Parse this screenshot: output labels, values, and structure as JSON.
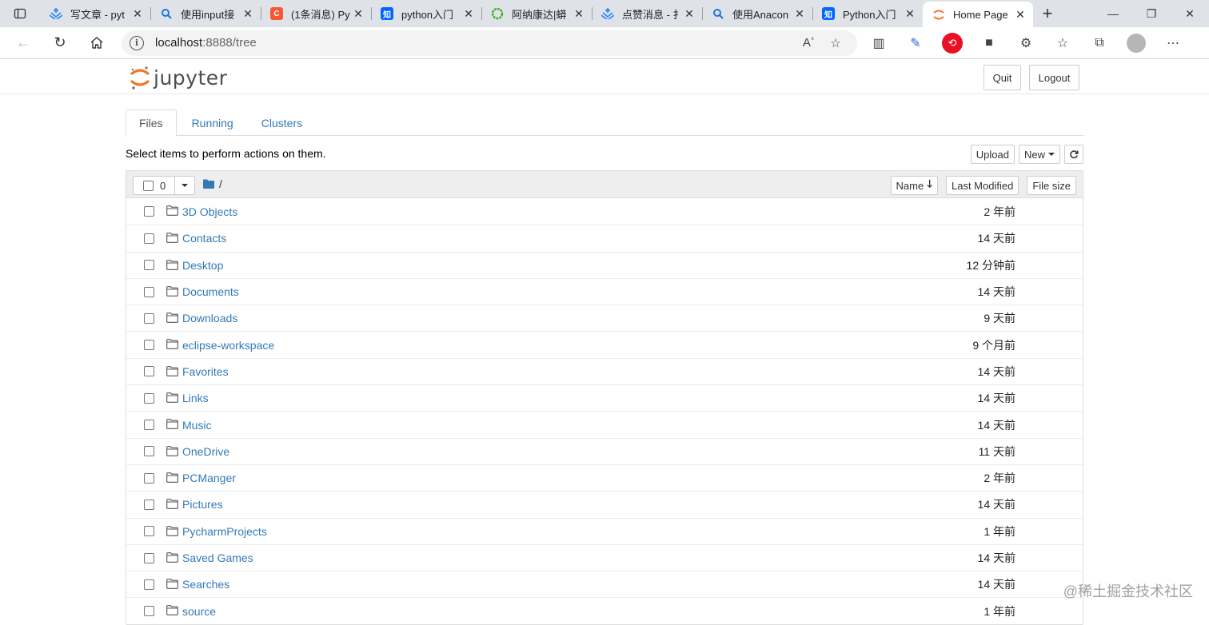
{
  "browser": {
    "tabs": [
      {
        "title": "写文章 - pyt",
        "favicon": "juejin-icon",
        "color": "#1e80ff"
      },
      {
        "title": "使用input接",
        "favicon": "search-icon",
        "color": "#1a73e8"
      },
      {
        "title": "(1条消息) Py",
        "favicon": "csdn-icon",
        "color": "#fc5531",
        "letter": "C"
      },
      {
        "title": "python入门",
        "favicon": "zhihu-icon",
        "color": "#0066ff",
        "letter": "知"
      },
      {
        "title": "阿纳康达|蟒",
        "favicon": "anaconda-icon",
        "color": "#43b02a"
      },
      {
        "title": "点赞消息 - 扌",
        "favicon": "juejin-icon",
        "color": "#1e80ff"
      },
      {
        "title": "使用Anacon",
        "favicon": "search-icon",
        "color": "#1a73e8"
      },
      {
        "title": "Python入门",
        "favicon": "zhihu-icon",
        "color": "#0066ff",
        "letter": "知"
      },
      {
        "title": "Home Page",
        "favicon": "jupyter-icon",
        "color": "#f37626",
        "active": true
      }
    ],
    "address": {
      "host": "localhost",
      "path": ":8888/tree"
    }
  },
  "jupyter": {
    "brand": "jupyter",
    "quit_label": "Quit",
    "logout_label": "Logout",
    "tabs": [
      {
        "label": "Files",
        "active": true
      },
      {
        "label": "Running"
      },
      {
        "label": "Clusters"
      }
    ],
    "instructions": "Select items to perform actions on them.",
    "upload_label": "Upload",
    "new_label": "New",
    "selected_count": "0",
    "breadcrumb": "/",
    "sort": {
      "name_label": "Name",
      "modified_label": "Last Modified",
      "size_label": "File size"
    },
    "files": [
      {
        "name": "3D Objects",
        "modified": "2 年前"
      },
      {
        "name": "Contacts",
        "modified": "14 天前"
      },
      {
        "name": "Desktop",
        "modified": "12 分钟前"
      },
      {
        "name": "Documents",
        "modified": "14 天前"
      },
      {
        "name": "Downloads",
        "modified": "9 天前"
      },
      {
        "name": "eclipse-workspace",
        "modified": "9 个月前"
      },
      {
        "name": "Favorites",
        "modified": "14 天前"
      },
      {
        "name": "Links",
        "modified": "14 天前"
      },
      {
        "name": "Music",
        "modified": "14 天前"
      },
      {
        "name": "OneDrive",
        "modified": "11 天前"
      },
      {
        "name": "PCManger",
        "modified": "2 年前"
      },
      {
        "name": "Pictures",
        "modified": "14 天前"
      },
      {
        "name": "PycharmProjects",
        "modified": "1 年前"
      },
      {
        "name": "Saved Games",
        "modified": "14 天前"
      },
      {
        "name": "Searches",
        "modified": "14 天前"
      },
      {
        "name": "source",
        "modified": "1 年前"
      }
    ]
  },
  "watermark": "@稀土掘金技术社区",
  "colors": {
    "link": "#337ab7",
    "jupyter_orange": "#f37626",
    "tabstrip": "#dfe3e8"
  }
}
